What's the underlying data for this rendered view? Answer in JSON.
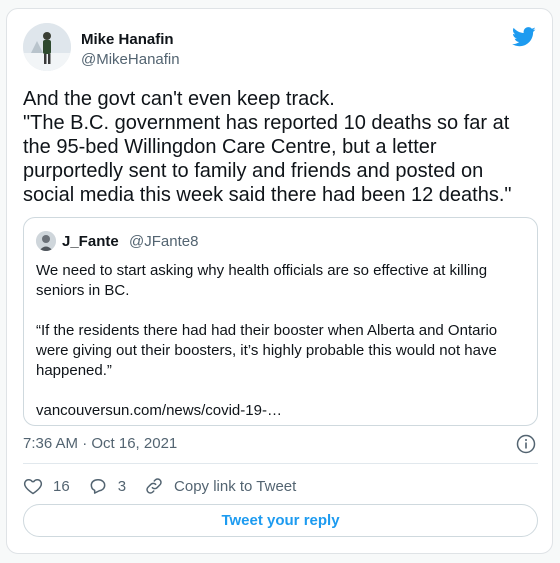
{
  "author": {
    "name": "Mike Hanafin",
    "handle": "@MikeHanafin"
  },
  "tweet": {
    "text": "And the govt can't even keep track.\n\"The B.C. government has reported 10 deaths so far at the 95-bed Willingdon Care Centre, but a letter purportedly sent to family and friends and posted on social media this week said there had been 12 deaths.\""
  },
  "quoted_tweet": {
    "name": "J_Fante",
    "handle": "@JFante8",
    "text": "We need to start asking why health officials are so effective at killing seniors in BC.\n\n“If the residents there had had their booster when Alberta and Ontario were giving out their boosters, it’s highly probable this would not have happened.”\n\nvancouversun.com/news/covid-19-…"
  },
  "timestamp": "7:36 AM · Oct 16, 2021",
  "actions": {
    "likes": "16",
    "replies": "3",
    "copy_link_label": "Copy link to Tweet"
  },
  "reply_button_label": "Tweet your reply",
  "colors": {
    "accent": "#1d9bf0",
    "secondary_text": "#536471",
    "border": "#cfd9de"
  },
  "icons": {
    "brand": "twitter-bird-icon",
    "info": "info-icon",
    "like": "heart-icon",
    "reply": "reply-bubble-icon",
    "copy": "link-icon"
  }
}
